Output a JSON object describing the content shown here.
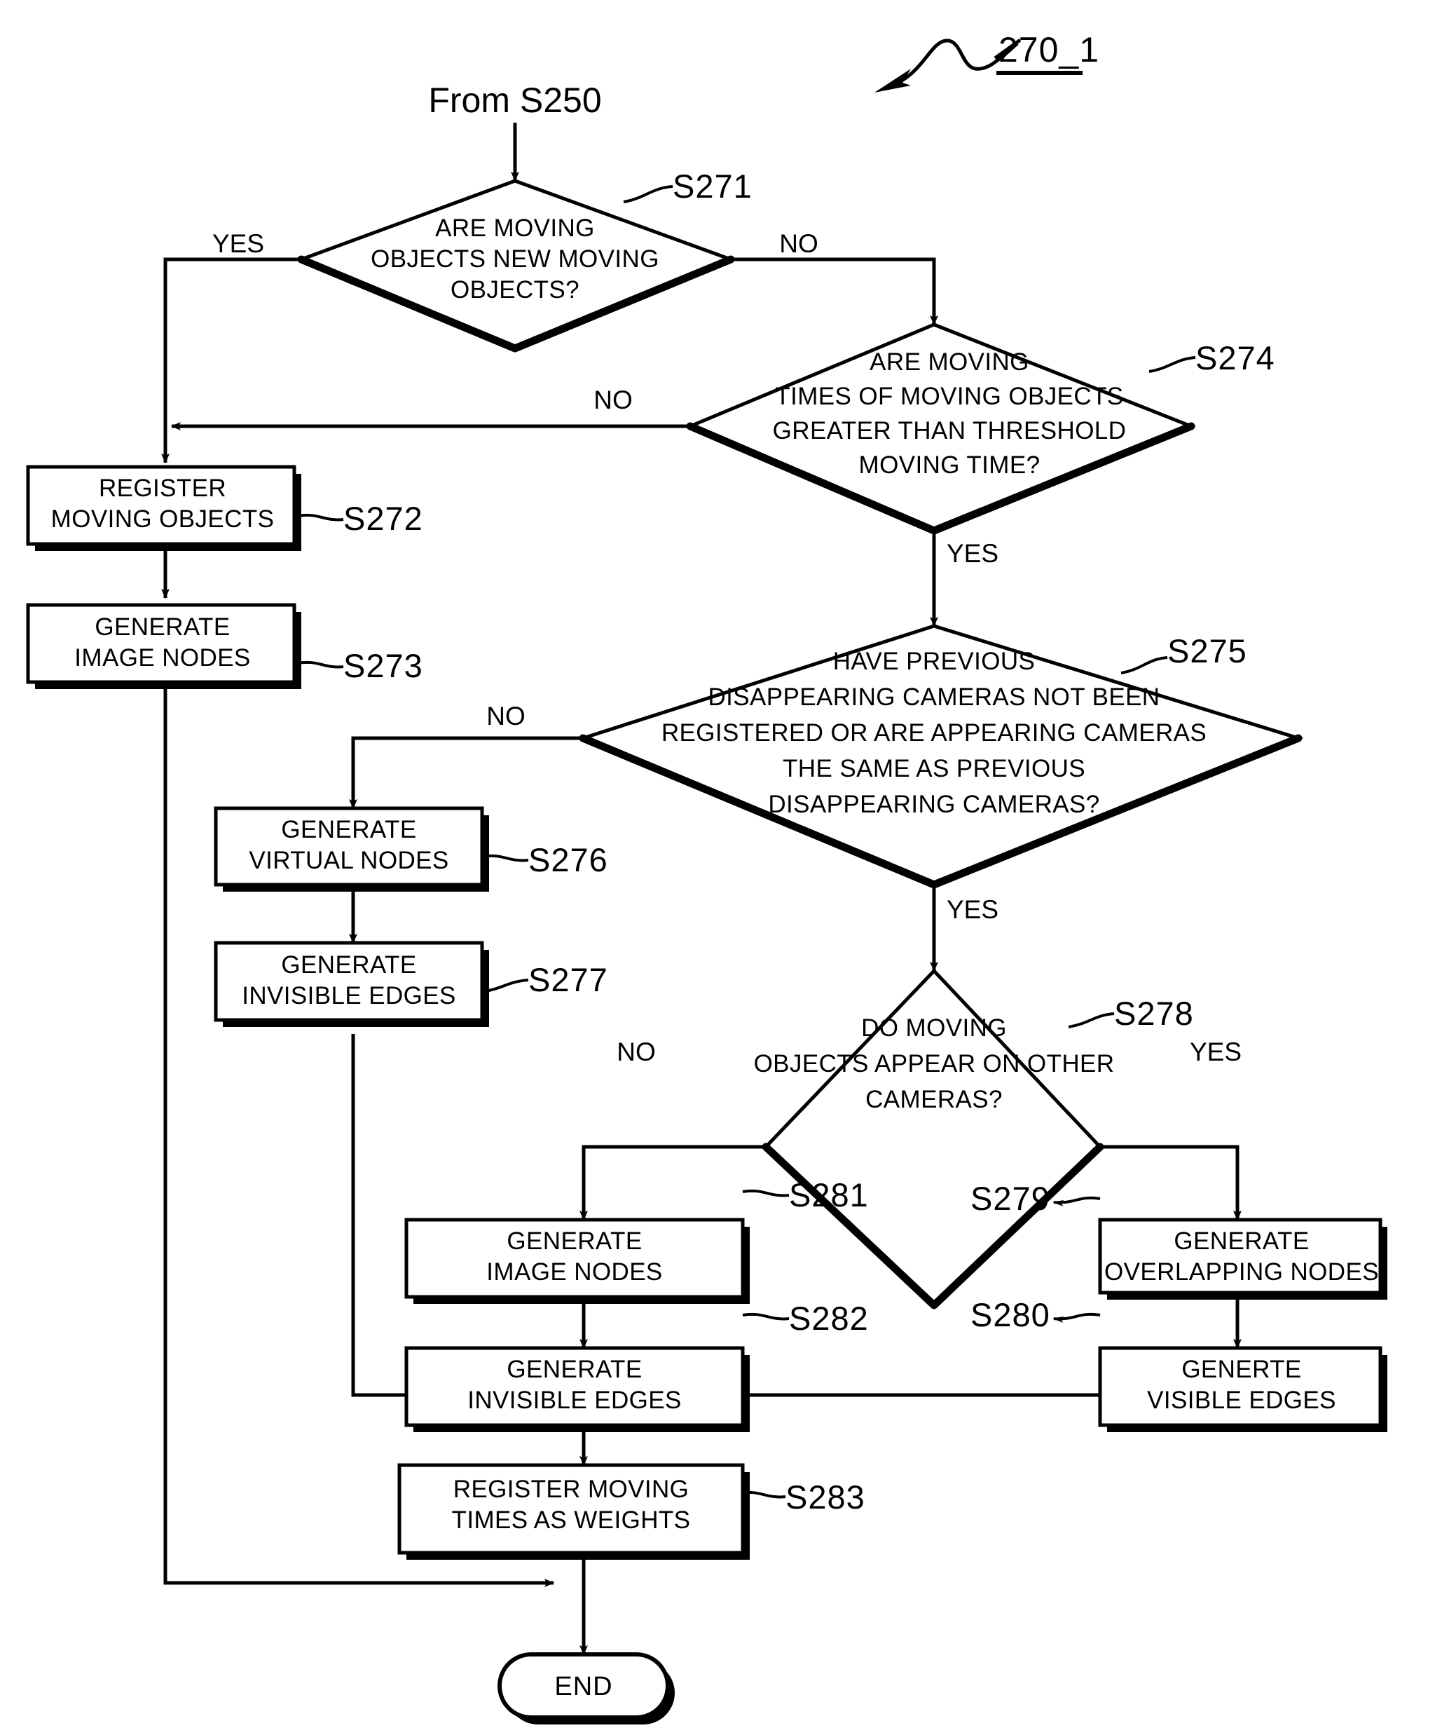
{
  "figure": {
    "ref_label": "270_1",
    "entry_label": "From S250"
  },
  "nodes": {
    "s271": {
      "id": "S271",
      "type": "decision",
      "lines": [
        "ARE MOVING",
        "OBJECTS NEW MOVING",
        "OBJECTS?"
      ],
      "branches": {
        "yes": "YES",
        "no": "NO"
      }
    },
    "s272": {
      "id": "S272",
      "type": "process",
      "lines": [
        "REGISTER",
        "MOVING OBJECTS"
      ]
    },
    "s273": {
      "id": "S273",
      "type": "process",
      "lines": [
        "GENERATE",
        "IMAGE NODES"
      ]
    },
    "s274": {
      "id": "S274",
      "type": "decision",
      "lines": [
        "ARE MOVING",
        "TIMES OF MOVING OBJECTS",
        "GREATER THAN THRESHOLD",
        "MOVING TIME?"
      ],
      "branches": {
        "yes": "YES",
        "no": "NO"
      }
    },
    "s275": {
      "id": "S275",
      "type": "decision",
      "lines": [
        "HAVE PREVIOUS",
        "DISAPPEARING CAMERAS NOT BEEN",
        "REGISTERED OR ARE APPEARING CAMERAS",
        "THE SAME AS PREVIOUS",
        "DISAPPEARING CAMERAS?"
      ],
      "branches": {
        "yes": "YES",
        "no": "NO"
      }
    },
    "s276": {
      "id": "S276",
      "type": "process",
      "lines": [
        "GENERATE",
        "VIRTUAL NODES"
      ]
    },
    "s277": {
      "id": "S277",
      "type": "process",
      "lines": [
        "GENERATE",
        "INVISIBLE EDGES"
      ]
    },
    "s278": {
      "id": "S278",
      "type": "decision",
      "lines": [
        "DO MOVING",
        "OBJECTS APPEAR ON OTHER",
        "CAMERAS?"
      ],
      "branches": {
        "yes": "YES",
        "no": "NO"
      }
    },
    "s279": {
      "id": "S279",
      "type": "process",
      "lines": [
        "GENERATE",
        "OVERLAPPING NODES"
      ]
    },
    "s280": {
      "id": "S280",
      "type": "process",
      "lines": [
        "GENERTE",
        "VISIBLE EDGES"
      ]
    },
    "s281": {
      "id": "S281",
      "type": "process",
      "lines": [
        "GENERATE",
        "IMAGE NODES"
      ]
    },
    "s282": {
      "id": "S282",
      "type": "process",
      "lines": [
        "GENERATE",
        "INVISIBLE EDGES"
      ]
    },
    "s283": {
      "id": "S283",
      "type": "process",
      "lines": [
        "REGISTER MOVING",
        "TIMES AS WEIGHTS"
      ]
    },
    "end": {
      "type": "terminator",
      "label": "END"
    }
  },
  "colors": {
    "stroke": "#000000",
    "fill": "#ffffff"
  }
}
